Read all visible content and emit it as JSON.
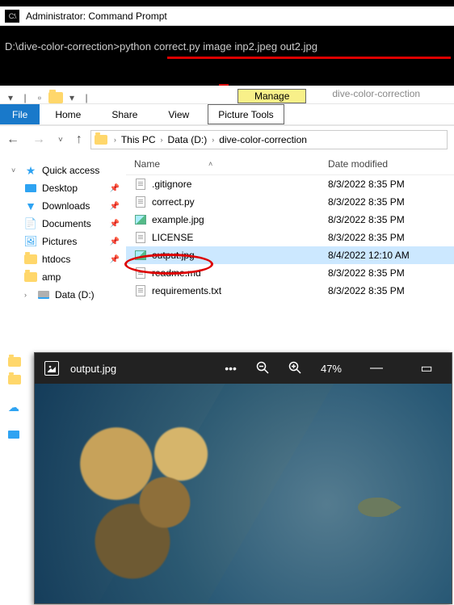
{
  "cmd": {
    "title": "Administrator: Command Prompt",
    "promptPath": "D:\\dive-color-correction>",
    "command": "python correct.py image inp2.jpeg out2.jpg"
  },
  "explorer": {
    "contextTab": "Manage",
    "contextLabel": "dive-color-correction",
    "tabs": {
      "file": "File",
      "home": "Home",
      "share": "Share",
      "view": "View",
      "tools": "Picture Tools"
    },
    "breadcrumb": [
      "This PC",
      "Data (D:)",
      "dive-color-correction"
    ],
    "columns": {
      "name": "Name",
      "date": "Date modified"
    },
    "sidebar": {
      "quickAccess": "Quick access",
      "items": [
        {
          "label": "Desktop",
          "pinned": true
        },
        {
          "label": "Downloads",
          "pinned": true
        },
        {
          "label": "Documents",
          "pinned": true
        },
        {
          "label": "Pictures",
          "pinned": true
        },
        {
          "label": "htdocs",
          "pinned": true
        },
        {
          "label": "amp",
          "pinned": false
        },
        {
          "label": "Data (D:)",
          "pinned": false
        }
      ]
    },
    "files": [
      {
        "name": ".gitignore",
        "date": "8/3/2022 8:35 PM",
        "type": "txt"
      },
      {
        "name": "correct.py",
        "date": "8/3/2022 8:35 PM",
        "type": "txt"
      },
      {
        "name": "example.jpg",
        "date": "8/3/2022 8:35 PM",
        "type": "img"
      },
      {
        "name": "LICENSE",
        "date": "8/3/2022 8:35 PM",
        "type": "txt"
      },
      {
        "name": "output.jpg",
        "date": "8/4/2022 12:10 AM",
        "type": "img",
        "selected": true
      },
      {
        "name": "readme.md",
        "date": "8/3/2022 8:35 PM",
        "type": "txt"
      },
      {
        "name": "requirements.txt",
        "date": "8/3/2022 8:35 PM",
        "type": "txt"
      }
    ]
  },
  "photos": {
    "filename": "output.jpg",
    "menuDots": "•••",
    "zoom": "47%"
  }
}
